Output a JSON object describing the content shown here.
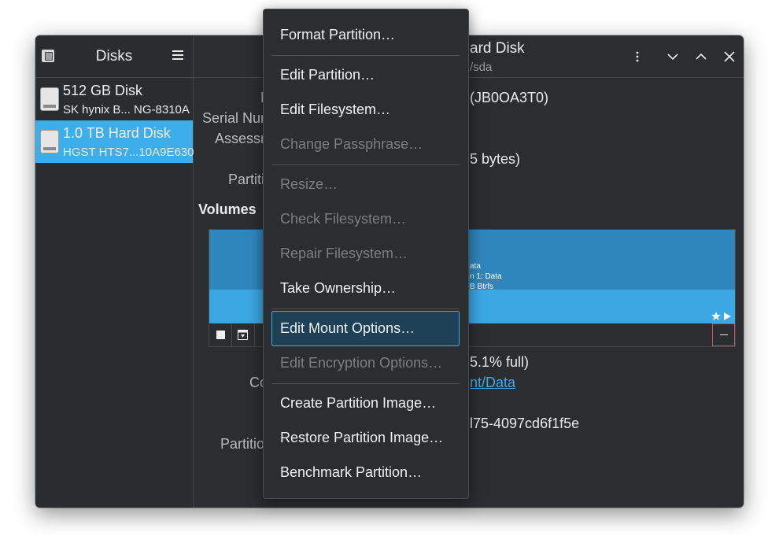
{
  "sidebar": {
    "title": "Disks",
    "disks": [
      {
        "name": "512 GB Disk",
        "detail": "SK hynix B... NG-8310A"
      },
      {
        "name": "1.0 TB Hard Disk",
        "detail": "HGST HTS7...10A9E630"
      }
    ]
  },
  "header": {
    "title": "ard Disk",
    "subtitle": "/sda"
  },
  "details": {
    "label_model": "M",
    "label_serial": "Serial Num",
    "label_assessment": "Assessm",
    "label_partitioning": "Partitio",
    "serial_value": "(JB0OA3T0)",
    "size_value": "5 bytes)",
    "volumes_heading": "Volumes"
  },
  "volume_bar": {
    "line1": "ata",
    "line2": "n 1: Data",
    "line3": "B Btrfs"
  },
  "volume_details": {
    "usage_value": "5.1% full)",
    "label_contents": "Cor",
    "mount_link": "nt/Data",
    "label_device": "D",
    "uuid_value": "l75-4097cd6f1f5e",
    "label_partition": "Partition"
  },
  "menu": {
    "items": [
      {
        "label": "Format Partition…",
        "enabled": true
      },
      {
        "label": "Edit Partition…",
        "enabled": true
      },
      {
        "label": "Edit Filesystem…",
        "enabled": true
      },
      {
        "label": "Change Passphrase…",
        "enabled": false
      },
      {
        "label": "Resize…",
        "enabled": false
      },
      {
        "label": "Check Filesystem…",
        "enabled": false
      },
      {
        "label": "Repair Filesystem…",
        "enabled": false
      },
      {
        "label": "Take Ownership…",
        "enabled": true
      },
      {
        "label": "Edit Mount Options…",
        "enabled": true,
        "highlighted": true
      },
      {
        "label": "Edit Encryption Options…",
        "enabled": false
      },
      {
        "label": "Create Partition Image…",
        "enabled": true
      },
      {
        "label": "Restore Partition Image…",
        "enabled": true
      },
      {
        "label": "Benchmark Partition…",
        "enabled": true
      }
    ]
  },
  "colors": {
    "accent": "#3daee9",
    "window_bg": "#2b2e31",
    "menu_highlight": "#1f4157",
    "volume_bar": "#2f86bd"
  }
}
